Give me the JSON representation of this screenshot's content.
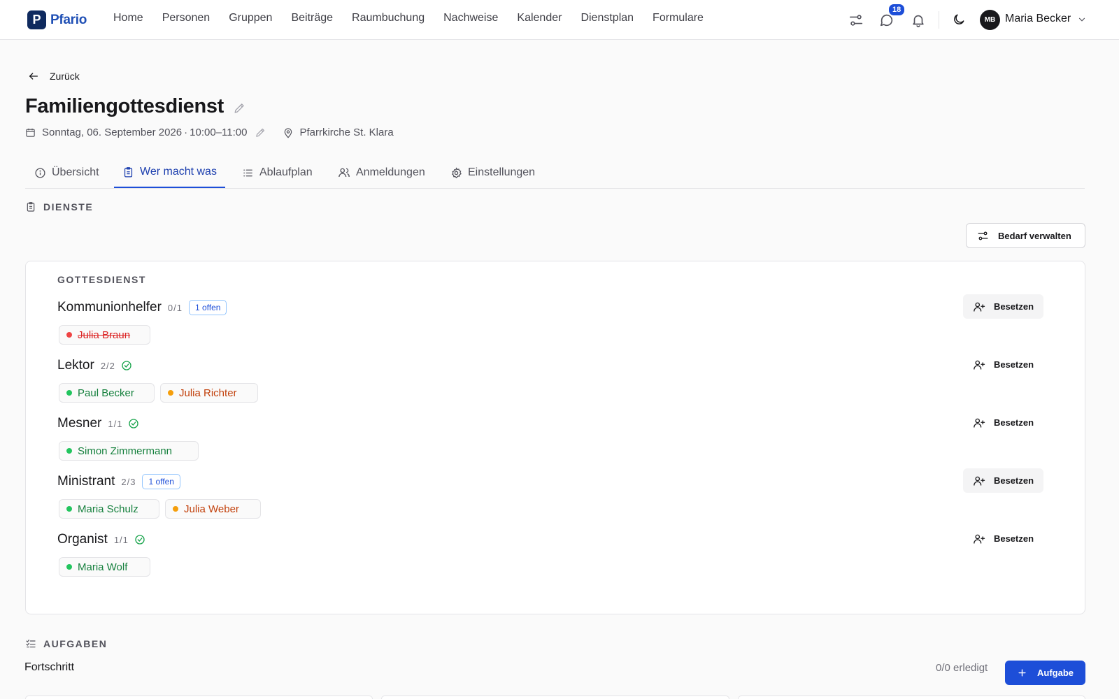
{
  "app": {
    "logo_letter": "P",
    "logo_text": "Pfario",
    "brand_color": "#1d4ed8"
  },
  "nav": {
    "items": [
      "Home",
      "Personen",
      "Gruppen",
      "Beiträge",
      "Raumbuchung",
      "Nachweise",
      "Kalender",
      "Dienstplan",
      "Formulare"
    ]
  },
  "header": {
    "messages_badge": "18",
    "user_initials": "MB",
    "user_name": "Maria Becker"
  },
  "page": {
    "back_label": "Zurück",
    "title": "Familiengottesdienst",
    "date_text": "Sonntag, 06. September 2026",
    "time_sep": "·",
    "time_text": "10:00–11:00",
    "location": "Pfarrkirche St. Klara"
  },
  "tabs": [
    {
      "label": "Übersicht",
      "icon": "info-icon"
    },
    {
      "label": "Wer macht was",
      "icon": "clipboard-icon",
      "active": true
    },
    {
      "label": "Ablaufplan",
      "icon": "list-icon"
    },
    {
      "label": "Anmeldungen",
      "icon": "users-icon"
    },
    {
      "label": "Einstellungen",
      "icon": "gear-icon"
    }
  ],
  "dienste": {
    "section_title": "DIENSTE",
    "manage_button": "Bedarf verwalten",
    "group_label": "GOTTESDIENST",
    "assign_label": "Besetzen",
    "roles": [
      {
        "name": "Kommunionhelfer",
        "count": "0/1",
        "open": "1 offen",
        "people": [
          {
            "name": "Julia Braun",
            "status": "red"
          }
        ]
      },
      {
        "name": "Lektor",
        "count": "2/2",
        "people": [
          {
            "name": "Paul Becker",
            "status": "green"
          },
          {
            "name": "Julia Richter",
            "status": "orange"
          }
        ]
      },
      {
        "name": "Mesner",
        "count": "1/1",
        "people": [
          {
            "name": "Simon Zimmermann",
            "status": "green"
          }
        ]
      },
      {
        "name": "Ministrant",
        "count": "2/3",
        "open": "1 offen",
        "people": [
          {
            "name": "Maria Schulz",
            "status": "green"
          },
          {
            "name": "Julia Weber",
            "status": "orange"
          }
        ]
      },
      {
        "name": "Organist",
        "count": "1/1",
        "people": [
          {
            "name": "Maria Wolf",
            "status": "green"
          }
        ]
      }
    ]
  },
  "aufgaben": {
    "section_title": "AUFGABEN",
    "progress_label": "Fortschritt",
    "progress_value": "0/0 erledigt",
    "add_button": "Aufgabe"
  }
}
